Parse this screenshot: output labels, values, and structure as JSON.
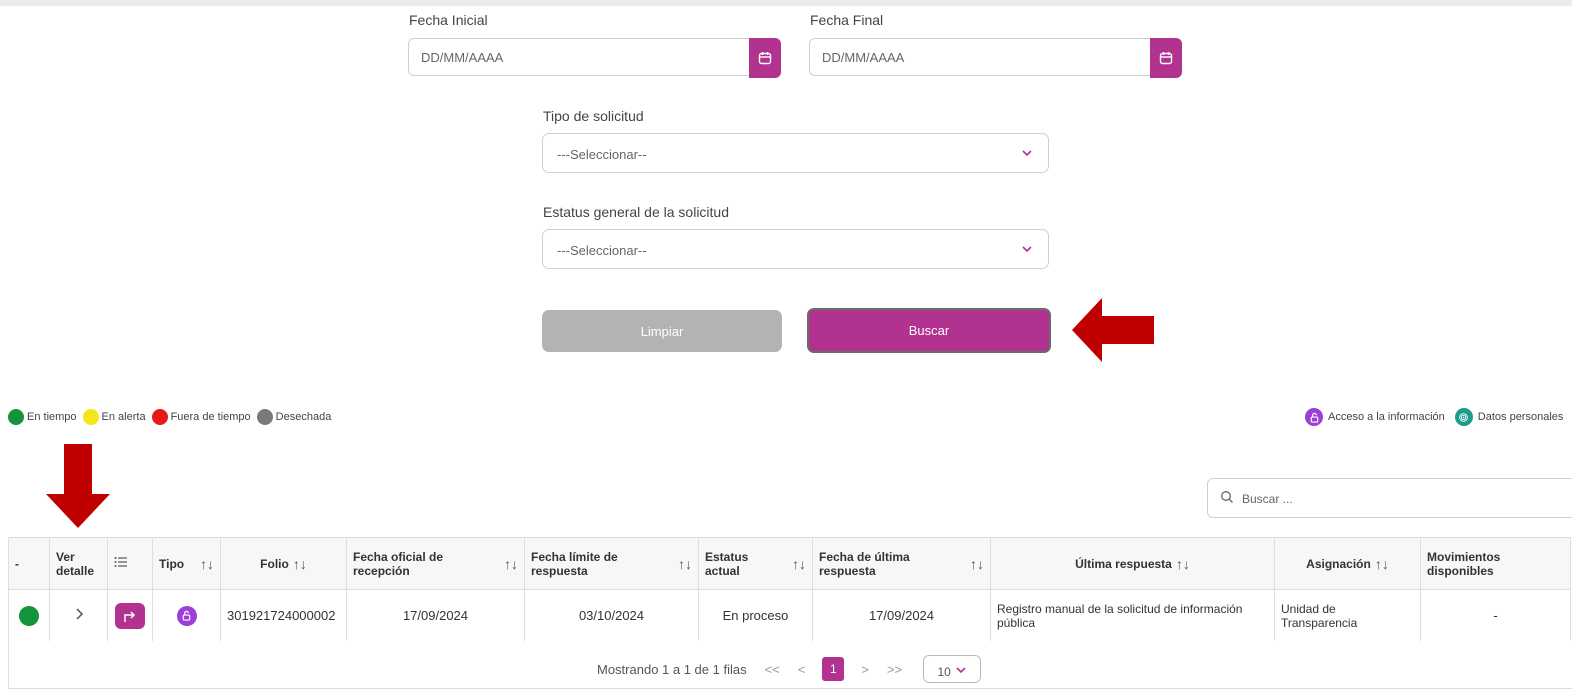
{
  "filters": {
    "fecha_inicial": {
      "label": "Fecha Inicial",
      "placeholder": "DD/MM/AAAA"
    },
    "fecha_final": {
      "label": "Fecha Final",
      "placeholder": "DD/MM/AAAA"
    },
    "tipo_solicitud": {
      "label": "Tipo de solicitud",
      "value": "---Seleccionar--"
    },
    "estatus_general": {
      "label": "Estatus general de la solicitud",
      "value": "---Seleccionar--"
    }
  },
  "actions": {
    "clear_label": "Limpiar",
    "search_label": "Buscar"
  },
  "legend": {
    "status": [
      {
        "label": "En tiempo",
        "color": "#14943c"
      },
      {
        "label": "En alerta",
        "color": "#f5e617"
      },
      {
        "label": "Fuera de tiempo",
        "color": "#e51a1a"
      },
      {
        "label": "Desechada",
        "color": "#7a7a7a"
      }
    ],
    "types": [
      {
        "label": "Acceso a la información",
        "color": "#9b3fd6",
        "icon": "lock-open-icon"
      },
      {
        "label": "Datos personales",
        "color": "#1d9c8c",
        "icon": "fingerprint-icon"
      }
    ]
  },
  "search": {
    "placeholder": "Buscar ..."
  },
  "table": {
    "columns": {
      "status": "-",
      "ver_detalle": "Ver detalle",
      "tipo": "Tipo",
      "folio": "Folio",
      "fecha_recepcion": "Fecha oficial de recepción",
      "fecha_limite": "Fecha límite de respuesta",
      "estatus_actual": "Estatus actual",
      "fecha_ultima": "Fecha de última respuesta",
      "ultima_respuesta": "Última respuesta",
      "asignacion": "Asignación",
      "movimientos": "Movimientos disponibles"
    },
    "sort_glyph": "↑↓",
    "rows": [
      {
        "status_color": "#14943c",
        "folio": "301921724000002",
        "fecha_recepcion": "17/09/2024",
        "fecha_limite": "03/10/2024",
        "estatus_actual": "En proceso",
        "fecha_ultima": "17/09/2024",
        "ultima_respuesta": "Registro manual de la solicitud de información pública",
        "asignacion": "Unidad de Transparencia",
        "movimientos": "-"
      }
    ]
  },
  "pagination": {
    "summary": "Mostrando 1 a 1 de 1 filas",
    "current_page": "1",
    "page_size": "10",
    "first": "<<",
    "prev": "<",
    "next": ">",
    "last": ">>"
  },
  "colors": {
    "accent": "#b2328f",
    "annotation_arrow": "#c00000"
  }
}
